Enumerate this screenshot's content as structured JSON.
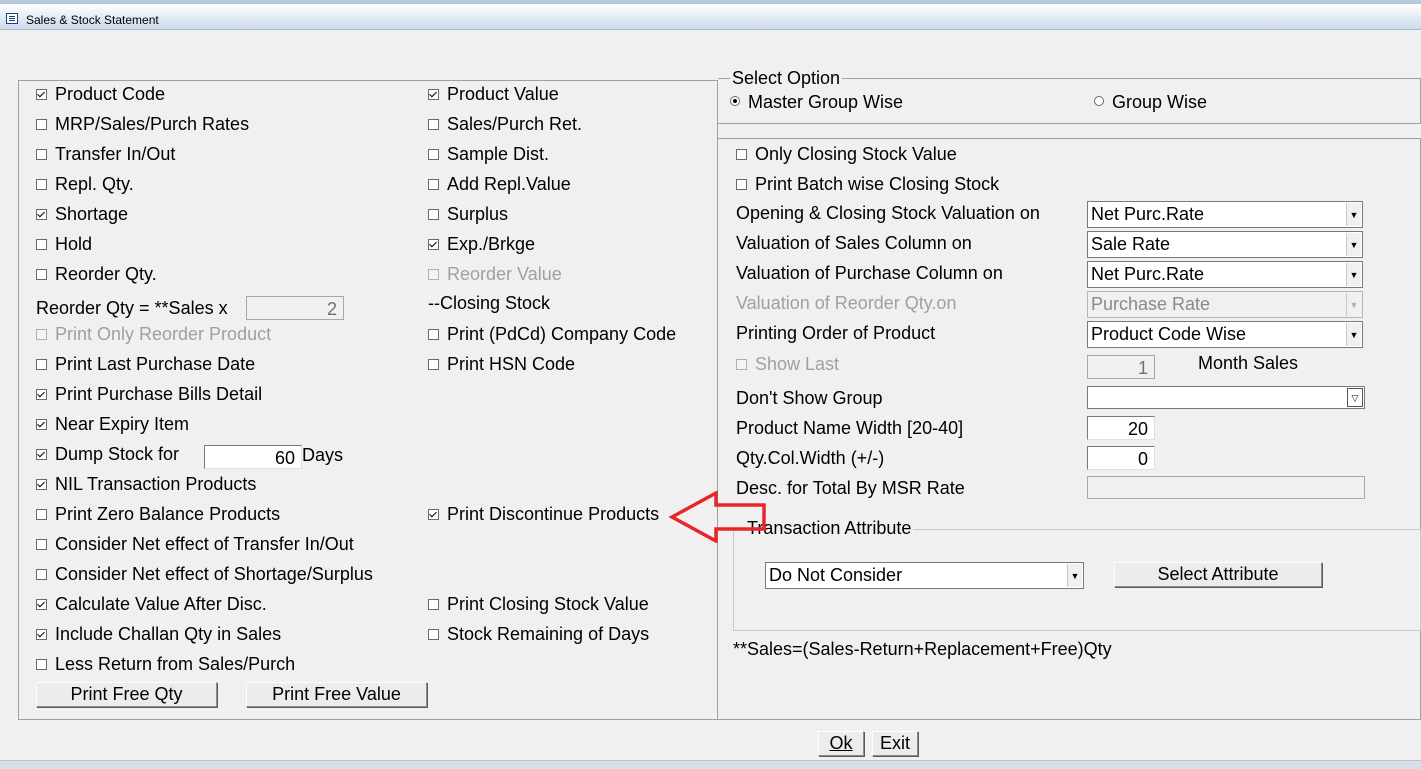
{
  "window": {
    "title": "Sales & Stock Statement"
  },
  "left": {
    "col1": [
      {
        "label": "Product Code",
        "checked": true
      },
      {
        "label": "MRP/Sales/Purch Rates",
        "checked": false
      },
      {
        "label": "Transfer In/Out",
        "checked": false
      },
      {
        "label": "Repl. Qty.",
        "checked": false
      },
      {
        "label": "Shortage",
        "checked": true
      },
      {
        "label": "Hold",
        "checked": false
      },
      {
        "label": "Reorder Qty.",
        "checked": false
      }
    ],
    "reorder_qty_label": "Reorder Qty = **Sales x",
    "reorder_qty_value": "2",
    "print_only_reorder": {
      "label": "Print Only Reorder Product",
      "checked": false
    },
    "print_last_purchase": {
      "label": "Print Last Purchase Date",
      "checked": false
    },
    "print_purchase_bills": {
      "label": "Print Purchase Bills Detail",
      "checked": true
    },
    "near_expiry": {
      "label": "Near Expiry Item",
      "checked": true
    },
    "dump_stock": {
      "label": "Dump Stock for",
      "checked": true,
      "value": "60",
      "suffix": "Days"
    },
    "nil_transaction": {
      "label": "NIL Transaction Products",
      "checked": true
    },
    "print_zero_balance": {
      "label": "Print Zero Balance Products",
      "checked": false
    },
    "net_transfer": {
      "label": "Consider Net effect of Transfer In/Out",
      "checked": false
    },
    "net_shortage": {
      "label": "Consider Net effect of Shortage/Surplus",
      "checked": false
    },
    "calc_after_disc": {
      "label": "Calculate Value After Disc.",
      "checked": true
    },
    "include_challan": {
      "label": "Include Challan Qty in Sales",
      "checked": true
    },
    "less_return": {
      "label": "Less Return from Sales/Purch",
      "checked": false
    },
    "col2": [
      {
        "label": "Product Value",
        "checked": true
      },
      {
        "label": "Sales/Purch Ret.",
        "checked": false
      },
      {
        "label": "Sample Dist.",
        "checked": false
      },
      {
        "label": "Add Repl.Value",
        "checked": false
      },
      {
        "label": "Surplus",
        "checked": false
      },
      {
        "label": "Exp./Brkge",
        "checked": true
      },
      {
        "label": "Reorder Value",
        "checked": false
      }
    ],
    "closing_stock_label": "--Closing Stock",
    "print_company_code": {
      "label": "Print (PdCd) Company Code",
      "checked": false
    },
    "print_hsn": {
      "label": "Print HSN Code",
      "checked": false
    },
    "print_discontinue": {
      "label": "Print Discontinue Products",
      "checked": true
    },
    "print_closing_value": {
      "label": "Print Closing Stock Value",
      "checked": false
    },
    "stock_remaining": {
      "label": "Stock Remaining of Days",
      "checked": false
    },
    "print_free_qty_btn": "Print Free Qty",
    "print_free_value_btn": "Print Free Value"
  },
  "select_option": {
    "title": "Select Option",
    "master_group": "Master Group Wise",
    "group_wise": "Group Wise",
    "selected": "master"
  },
  "right": {
    "only_closing": {
      "label": "Only Closing Stock Value",
      "checked": false
    },
    "batch_wise": {
      "label": "Print Batch wise Closing Stock",
      "checked": false
    },
    "opening_closing_label": "Opening & Closing Stock Valuation on",
    "opening_closing_value": "Net Purc.Rate",
    "sales_col_label": "Valuation of Sales Column on",
    "sales_col_value": "Sale Rate",
    "purchase_col_label": "Valuation of Purchase Column on",
    "purchase_col_value": "Net Purc.Rate",
    "reorder_val_label": "Valuation of Reorder Qty.on",
    "reorder_val_value": "Purchase Rate",
    "print_order_label": "Printing Order of Product",
    "print_order_value": "Product Code Wise",
    "show_last_label": "Show Last",
    "show_last_value": "1",
    "month_sales_label": "Month Sales",
    "dont_show_group_label": "Don't Show Group",
    "dont_show_group_value": "",
    "name_width_label": "Product Name Width [20-40]",
    "name_width_value": "20",
    "qty_col_label": "Qty.Col.Width (+/-)",
    "qty_col_value": "0",
    "desc_msr_label": "Desc. for Total By MSR Rate",
    "desc_msr_value": "",
    "transaction_attr_label": "Transaction Attribute",
    "transaction_attr_value": "Do Not Consider",
    "select_attr_btn": "Select Attribute",
    "footnote": "**Sales=(Sales-Return+Replacement+Free)Qty"
  },
  "footer": {
    "ok": "Ok",
    "exit": "Exit"
  },
  "annotation": {
    "arrow_color": "#e8262a"
  }
}
